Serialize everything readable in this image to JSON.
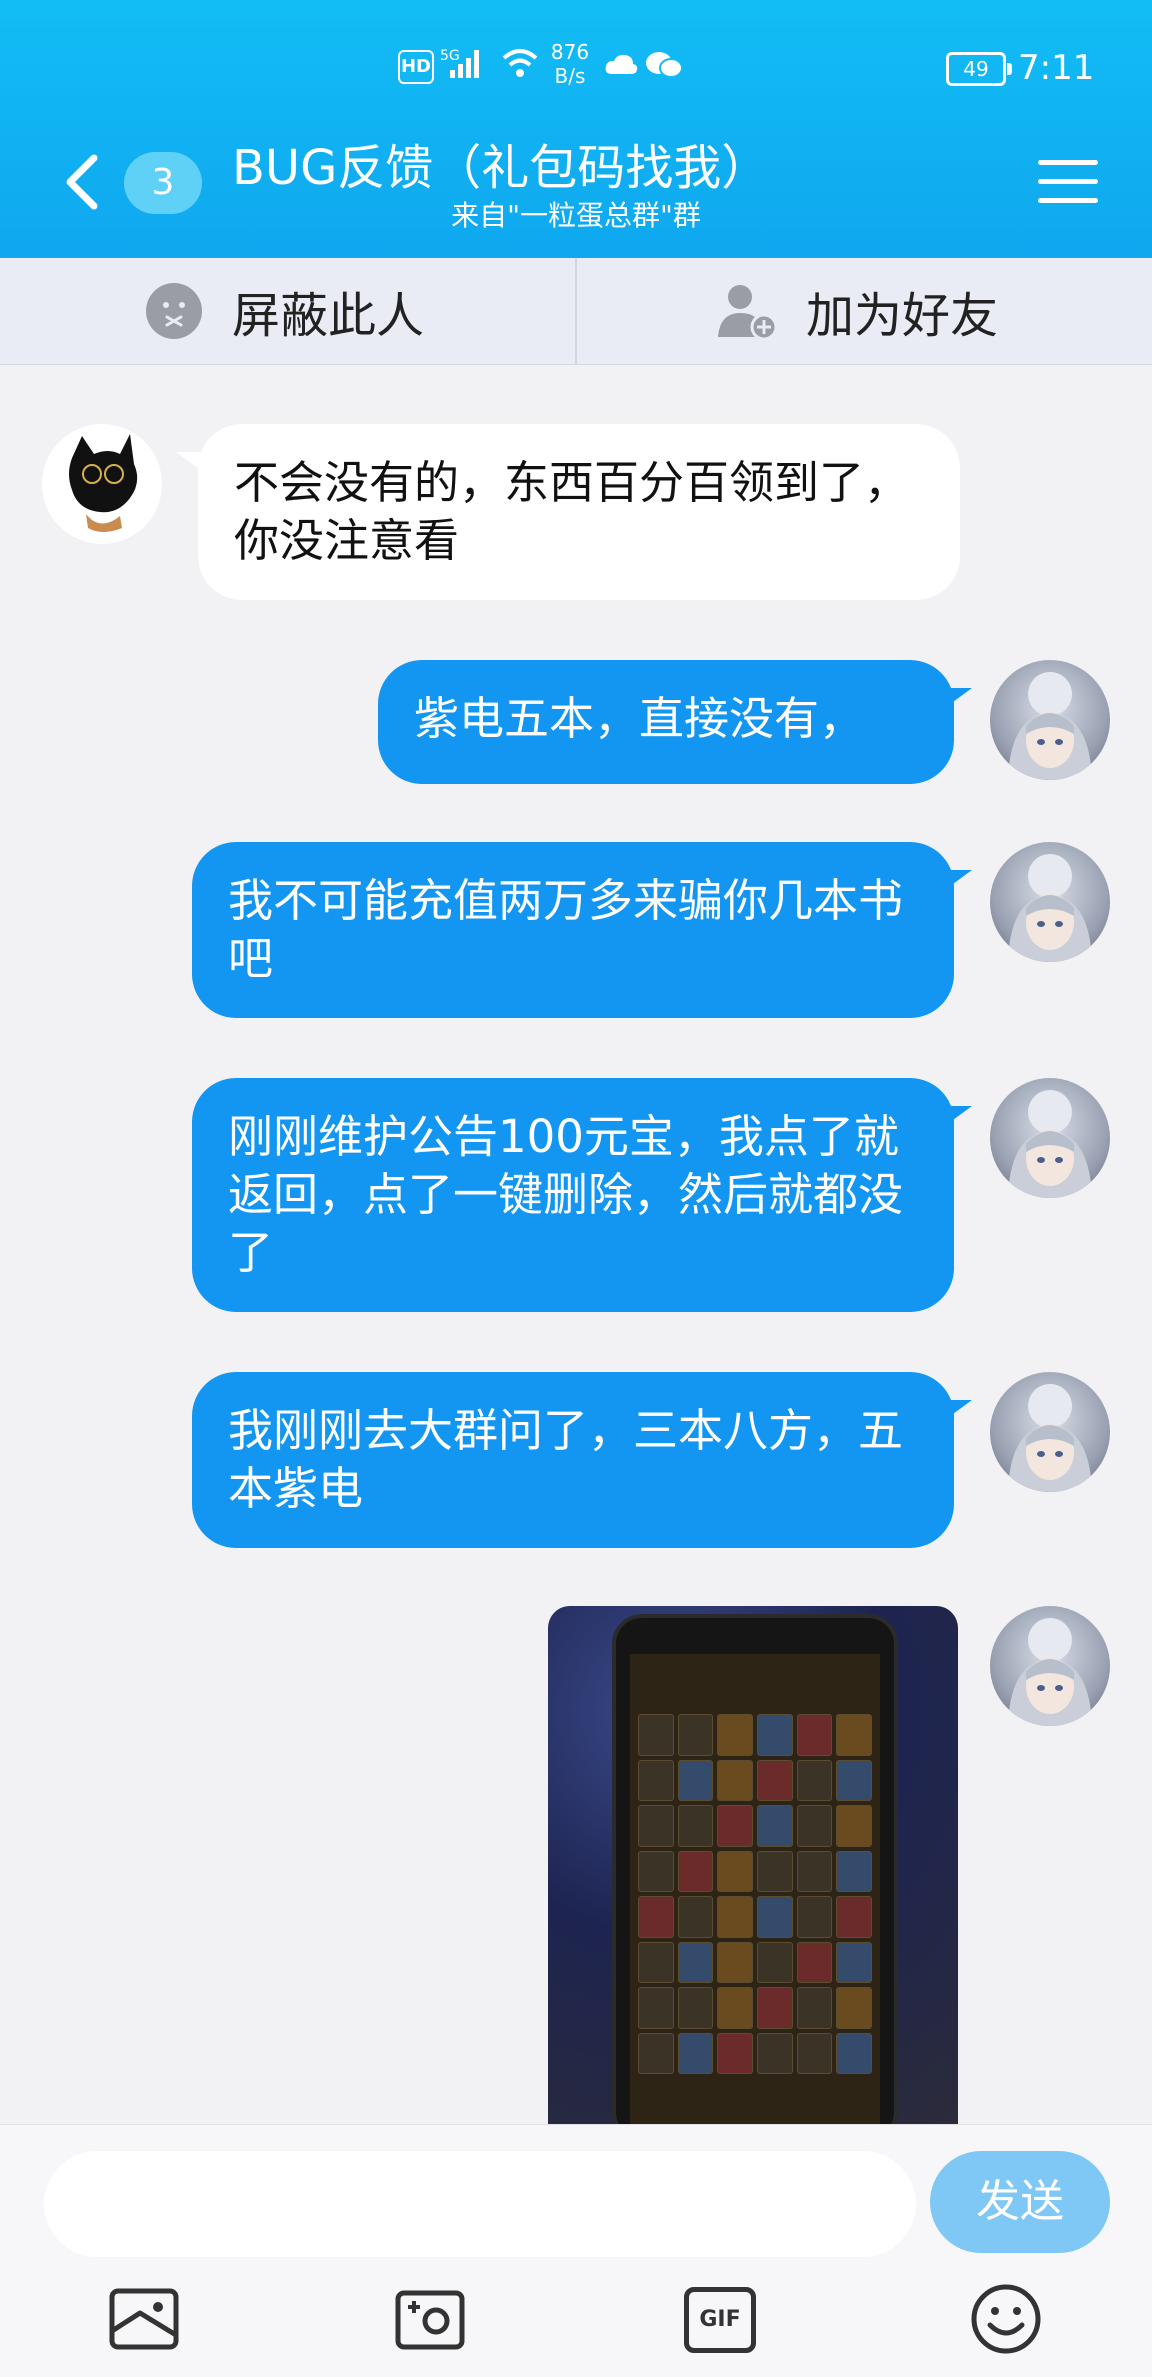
{
  "status_bar": {
    "hd": "HD",
    "signal_label": "5G",
    "net_speed_value": "876",
    "net_speed_unit": "B/s",
    "battery": "49",
    "time": "7:11"
  },
  "header": {
    "unread_count": "3",
    "title": "BUG反馈（礼包码找我）",
    "subtitle": "来自\"一粒蛋总群\"群"
  },
  "actions": {
    "block_label": "屏蔽此人",
    "add_friend_label": "加为好友"
  },
  "messages": [
    {
      "side": "left",
      "text": "不会没有的，东西百分百领到了，你没注意看"
    },
    {
      "side": "right",
      "text": "紫电五本，直接没有，"
    },
    {
      "side": "right",
      "text": "我不可能充值两万多来骗你几本书吧"
    },
    {
      "side": "right",
      "text": "刚刚维护公告100元宝，我点了就返回，点了一键删除，然后就都没了"
    },
    {
      "side": "right",
      "text": "我刚刚去大群问了，三本八方，五本紫电"
    },
    {
      "side": "right",
      "type": "image"
    }
  ],
  "input": {
    "placeholder": "",
    "send_label": "发送"
  },
  "toolbar": {
    "gif_label": "GIF"
  },
  "colors": {
    "header": "#12bdf5",
    "bubble_right": "#1296f2",
    "bubble_left": "#ffffff",
    "send_button": "#7fc8f5"
  }
}
